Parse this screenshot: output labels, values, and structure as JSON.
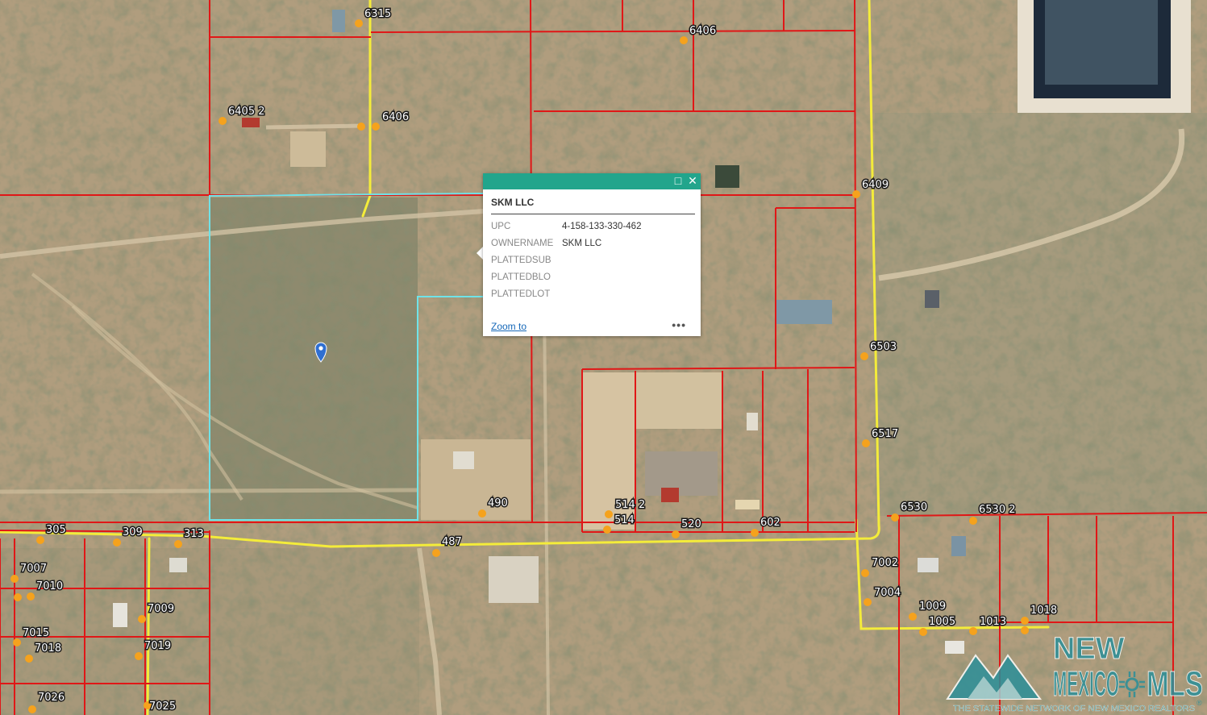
{
  "colors": {
    "parcel_line": "#e01717",
    "selected_parcel": "#6fe3e8",
    "road": "#f4ec3a",
    "address_dot": "#f5a21d",
    "popup_header": "#22a58c",
    "link": "#1668b8"
  },
  "map": {
    "marker_icon": "map-pin-icon",
    "address_labels": [
      "6315",
      "6406",
      "6405 2",
      "6406",
      "6409",
      "6503",
      "6517",
      "490",
      "514 2",
      "514",
      "520",
      "602",
      "487",
      "6530",
      "6530 2",
      "7002",
      "7004",
      "1009",
      "1005",
      "1013",
      "1018",
      "305",
      "309",
      "313",
      "7007",
      "7010",
      "7009",
      "7015",
      "7018",
      "7019",
      "7026",
      "7025"
    ]
  },
  "popup": {
    "title": "SKM LLC",
    "maximize_icon": "maximize-icon",
    "close_icon": "close-icon",
    "fields": [
      {
        "key": "UPC",
        "value": "4-158-133-330-462"
      },
      {
        "key": "OWNERNAME",
        "value": "SKM LLC"
      },
      {
        "key": "PLATTEDSUB",
        "value": ""
      },
      {
        "key": "PLATTEDBLO",
        "value": ""
      },
      {
        "key": "PLATTEDLOT",
        "value": ""
      }
    ],
    "zoom_link": "Zoom to",
    "more_icon": "more-options-icon"
  },
  "watermark": {
    "line1": "NEW",
    "line2": "MEXICO",
    "line3": "MLS",
    "tagline": "THE STATEWIDE NETWORK OF NEW MEXICO REALTORS",
    "registered": "®"
  }
}
